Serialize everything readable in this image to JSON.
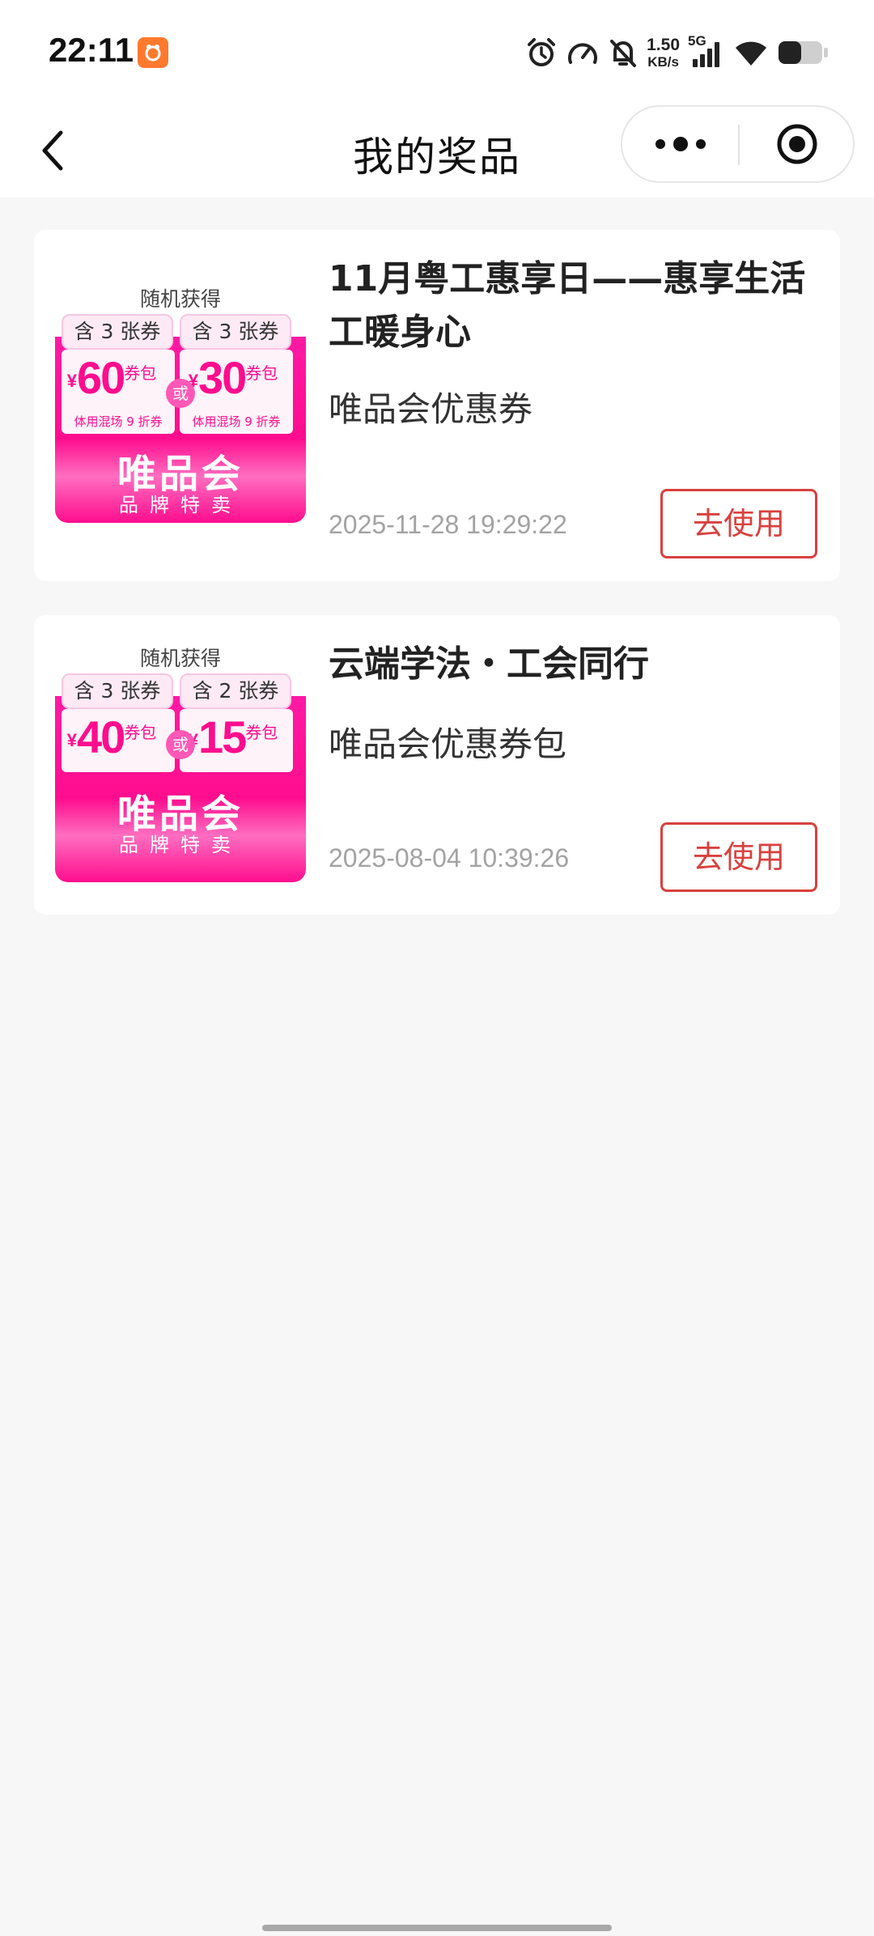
{
  "status_bar": {
    "time": "22:11",
    "net_speed_value": "1.50",
    "net_speed_unit": "KB/s",
    "network_type": "5G",
    "icons": [
      "app-notification-icon",
      "alarm-icon",
      "speedometer-icon",
      "mute-bell-icon",
      "signal-icon",
      "wifi-icon",
      "battery-icon"
    ]
  },
  "nav": {
    "title": "我的奖品"
  },
  "prizes": [
    {
      "title": "11月粤工惠享日——惠享生活工暖身心",
      "type": "唯品会优惠券",
      "date": "2025-11-28 19:29:22",
      "button": "去使用",
      "thumb": {
        "random": "随机获得",
        "pill_left": "含 3 张券",
        "pill_right": "含 3 张券",
        "amount_left": "60",
        "amount_right": "30",
        "currency": "¥",
        "pack": "券包",
        "plus": "+",
        "sub_left": "体用混场 9 折券",
        "sub_right": "体用混场 9 折券",
        "or": "或",
        "brand": "唯品会",
        "slogan": "品牌特卖"
      }
    },
    {
      "title": "云端学法・工会同行",
      "type": "唯品会优惠券包",
      "date": "2025-08-04 10:39:26",
      "button": "去使用",
      "thumb": {
        "random": "随机获得",
        "pill_left": "含 3 张券",
        "pill_right": "含 2 张券",
        "amount_left": "40",
        "amount_right": "15",
        "currency": "¥",
        "pack": "券包",
        "or": "或",
        "brand": "唯品会",
        "slogan": "品牌特卖"
      }
    }
  ],
  "colors": {
    "accent_red": "#d9413e",
    "brand_pink": "#ff0d8e",
    "page_bg": "#f7f7f7"
  }
}
